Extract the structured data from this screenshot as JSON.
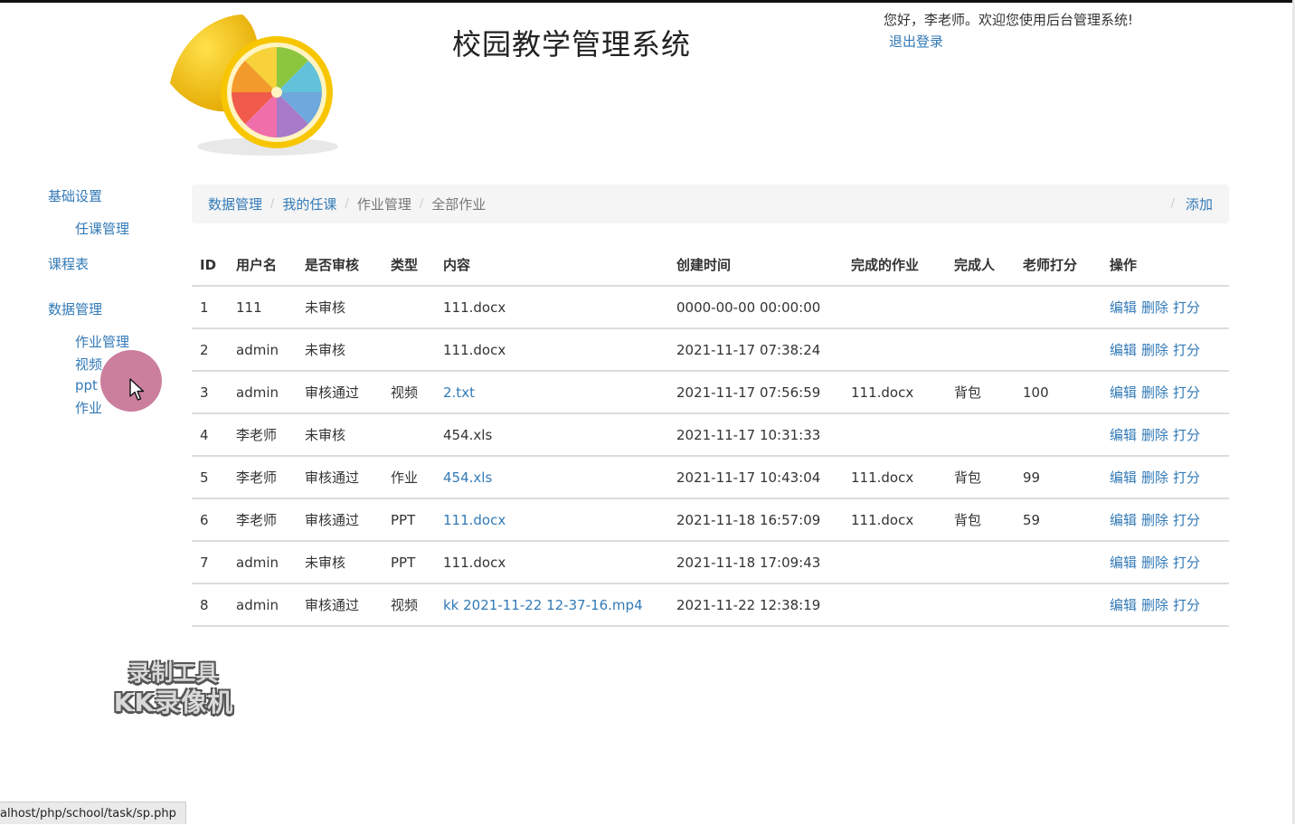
{
  "header": {
    "title": "校园教学管理系统",
    "welcome_text": "您好，李老师。欢迎您使用后台管理系统!",
    "logout_label": "退出登录"
  },
  "sidebar": {
    "groups": [
      {
        "label": "基础设置",
        "items": [
          "任课管理"
        ]
      },
      {
        "label": "课程表",
        "items": []
      },
      {
        "label": "数据管理",
        "items": [
          "作业管理",
          "视频",
          "ppt",
          "作业"
        ]
      }
    ]
  },
  "breadcrumb": {
    "items": [
      "数据管理",
      "我的任课",
      "作业管理",
      "全部作业"
    ],
    "separator": "/",
    "add_label": "添加"
  },
  "table": {
    "columns": [
      "ID",
      "用户名",
      "是否审核",
      "类型",
      "内容",
      "创建时间",
      "完成的作业",
      "完成人",
      "老师打分",
      "操作"
    ],
    "actions": [
      "编辑",
      "删除",
      "打分"
    ],
    "rows": [
      {
        "id": "1",
        "user": "111",
        "status": "未审核",
        "type": "",
        "content": "111.docx",
        "content_link": false,
        "created": "0000-00-00 00:00:00",
        "done": "",
        "doer": "",
        "score": ""
      },
      {
        "id": "2",
        "user": "admin",
        "status": "未审核",
        "type": "",
        "content": "111.docx",
        "content_link": false,
        "created": "2021-11-17 07:38:24",
        "done": "",
        "doer": "",
        "score": ""
      },
      {
        "id": "3",
        "user": "admin",
        "status": "审核通过",
        "type": "视频",
        "content": "2.txt",
        "content_link": true,
        "created": "2021-11-17 07:56:59",
        "done": "111.docx",
        "doer": "背包",
        "score": "100"
      },
      {
        "id": "4",
        "user": "李老师",
        "status": "未审核",
        "type": "",
        "content": "454.xls",
        "content_link": false,
        "created": "2021-11-17 10:31:33",
        "done": "",
        "doer": "",
        "score": ""
      },
      {
        "id": "5",
        "user": "李老师",
        "status": "审核通过",
        "type": "作业",
        "content": "454.xls",
        "content_link": true,
        "created": "2021-11-17 10:43:04",
        "done": "111.docx",
        "doer": "背包",
        "score": "99"
      },
      {
        "id": "6",
        "user": "李老师",
        "status": "审核通过",
        "type": "PPT",
        "content": "111.docx",
        "content_link": true,
        "created": "2021-11-18 16:57:09",
        "done": "111.docx",
        "doer": "背包",
        "score": "59"
      },
      {
        "id": "7",
        "user": "admin",
        "status": "未审核",
        "type": "PPT",
        "content": "111.docx",
        "content_link": false,
        "created": "2021-11-18 17:09:43",
        "done": "",
        "doer": "",
        "score": ""
      },
      {
        "id": "8",
        "user": "admin",
        "status": "审核通过",
        "type": "视频",
        "content": "kk 2021-11-22 12-37-16.mp4",
        "content_link": true,
        "created": "2021-11-22 12:38:19",
        "done": "",
        "doer": "",
        "score": ""
      }
    ]
  },
  "watermark": {
    "line1": "录制工具",
    "line2": "KK录像机"
  },
  "status_bar": {
    "url": "alhost/php/school/task/sp.php"
  },
  "colors": {
    "link": "#337ab7",
    "breadcrumb_bg": "#f5f5f5",
    "cursor_highlight": "#be5a82"
  },
  "icons": {
    "logo": "lemon-logo-icon",
    "cursor": "mouse-cursor-icon"
  }
}
